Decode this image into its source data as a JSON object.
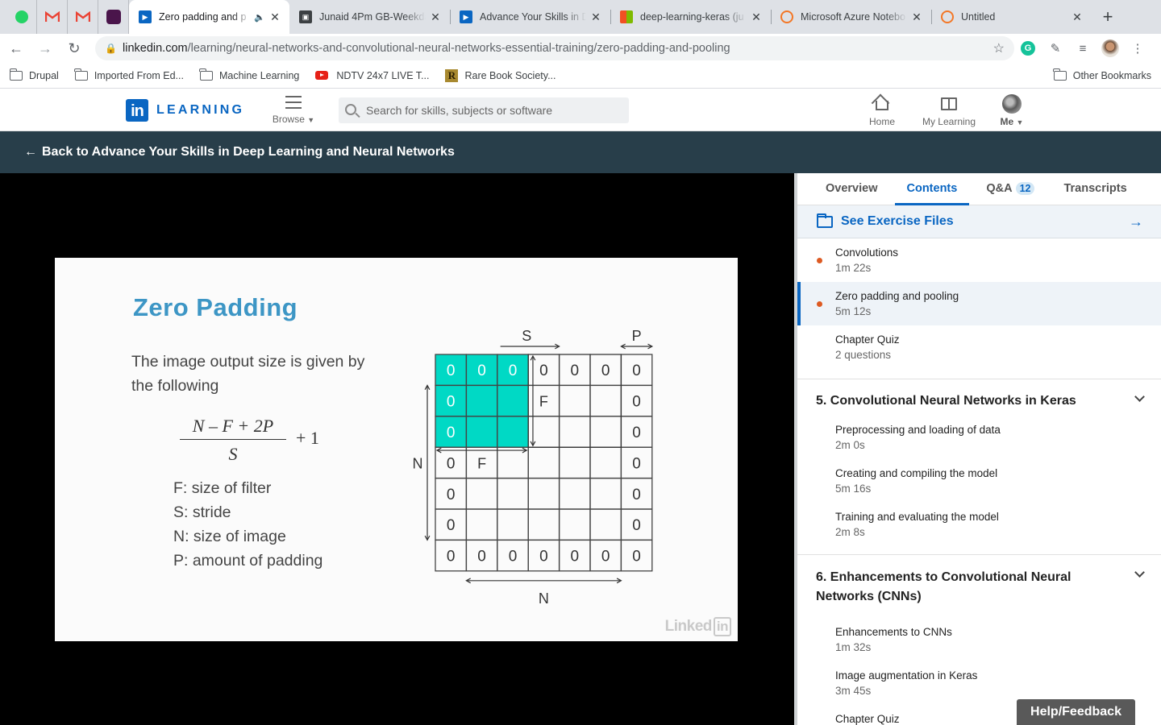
{
  "browser": {
    "pinned_tabs": [
      {
        "icon": "whatsapp-icon",
        "color": "#25d366"
      },
      {
        "icon": "gmail-icon",
        "color": "#ea4335"
      },
      {
        "icon": "gmail-icon",
        "color": "#ea4335"
      },
      {
        "icon": "slack-icon",
        "color": "#4a154b"
      }
    ],
    "tabs": [
      {
        "title": "Zero padding and p",
        "icon": "linkedin-learning-icon",
        "active": true,
        "audio": true
      },
      {
        "title": "Junaid 4Pm GB-Weekda",
        "icon": "contact-card-icon",
        "active": false
      },
      {
        "title": "Advance Your Skills in D",
        "icon": "linkedin-learning-icon",
        "active": false
      },
      {
        "title": "deep-learning-keras (ju",
        "icon": "microsoft-icon",
        "active": false
      },
      {
        "title": "Microsoft Azure Notebo",
        "icon": "jupyter-icon",
        "active": false
      },
      {
        "title": "Untitled",
        "icon": "jupyter-icon",
        "active": false
      }
    ],
    "url_host": "linkedin.com",
    "url_path": "/learning/neural-networks-and-convolutional-neural-networks-essential-training/zero-padding-and-pooling",
    "bookmarks": [
      {
        "label": "Drupal",
        "icon": "folder-icon"
      },
      {
        "label": "Imported From Ed...",
        "icon": "folder-icon"
      },
      {
        "label": "Machine Learning",
        "icon": "folder-icon"
      },
      {
        "label": "NDTV 24x7 LIVE T...",
        "icon": "youtube-icon"
      },
      {
        "label": "Rare Book Society...",
        "icon": "rare-book-icon"
      }
    ],
    "other_bookmarks": "Other Bookmarks"
  },
  "header": {
    "logo_text": "LEARNING",
    "browse_label": "Browse",
    "search_placeholder": "Search for skills, subjects or software",
    "home_label": "Home",
    "my_learning_label": "My Learning",
    "me_label": "Me"
  },
  "back_link": "Back to Advance Your Skills in Deep Learning and Neural Networks",
  "slide": {
    "title": "Zero Padding",
    "intro": "The image output size is given by the following",
    "numerator": "N – F + 2P",
    "denominator": "S",
    "plus_one": "+ 1",
    "definitions": [
      "F: size of filter",
      "S: stride",
      "N: size of image",
      "P: amount of padding"
    ],
    "watermark_word": "Linked",
    "watermark_box": "in",
    "diagram": {
      "label_s": "S",
      "label_p": "P",
      "label_n_left": "N",
      "label_n_bottom": "N",
      "label_f_top": "F",
      "label_f_left": "F",
      "grid": [
        [
          "0",
          "0",
          "0",
          "0",
          "0",
          "0",
          "0"
        ],
        [
          "0",
          "",
          "",
          "",
          "",
          "",
          "0"
        ],
        [
          "0",
          "",
          "",
          "",
          "",
          "",
          "0"
        ],
        [
          "0",
          "",
          "",
          "",
          "",
          "",
          "0"
        ],
        [
          "0",
          "",
          "",
          "",
          "",
          "",
          "0"
        ],
        [
          "0",
          "",
          "",
          "",
          "",
          "",
          "0"
        ],
        [
          "0",
          "0",
          "0",
          "0",
          "0",
          "0",
          "0"
        ]
      ],
      "highlight_color": "#00d9c5"
    }
  },
  "sidebar": {
    "tabs": [
      {
        "label": "Overview",
        "active": false
      },
      {
        "label": "Contents",
        "active": true
      },
      {
        "label": "Q&A",
        "badge": "12",
        "active": false
      },
      {
        "label": "Transcripts",
        "active": false
      }
    ],
    "exercise_files": "See Exercise Files",
    "items_top": [
      {
        "title": "Convolutions",
        "duration": "1m 22s",
        "dot": true,
        "current": false
      },
      {
        "title": "Zero padding and pooling",
        "duration": "5m 12s",
        "dot": true,
        "current": true
      },
      {
        "title": "Chapter Quiz",
        "duration": "2 questions",
        "dot": false,
        "current": false
      }
    ],
    "chapter5": {
      "title": "5. Convolutional Neural Networks in Keras",
      "items": [
        {
          "title": "Preprocessing and loading of data",
          "duration": "2m 0s"
        },
        {
          "title": "Creating and compiling the model",
          "duration": "5m 16s"
        },
        {
          "title": "Training and evaluating the model",
          "duration": "2m 8s"
        }
      ]
    },
    "chapter6": {
      "title": "6. Enhancements to Convolutional Neural Networks (CNNs)",
      "items": [
        {
          "title": "Enhancements to CNNs",
          "duration": "1m 32s"
        },
        {
          "title": "Image augmentation in Keras",
          "duration": "3m 45s"
        },
        {
          "title": "Chapter Quiz",
          "duration": ""
        }
      ]
    }
  },
  "help_feedback": "Help/Feedback"
}
